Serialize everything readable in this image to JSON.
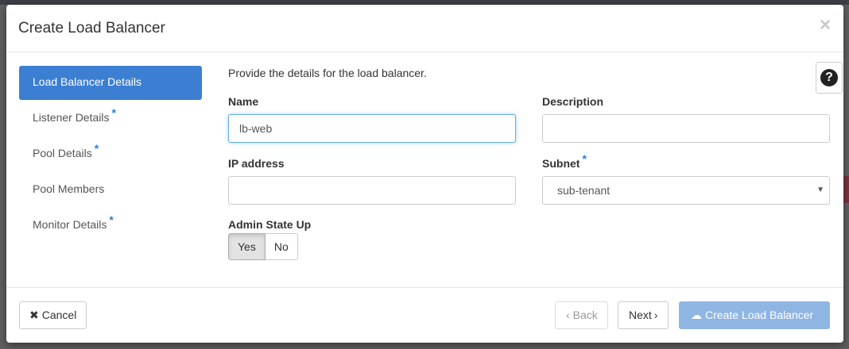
{
  "modal": {
    "title": "Create Load Balancer",
    "close_glyph": "×"
  },
  "wizard": {
    "steps": [
      {
        "label": "Load Balancer Details",
        "required": false,
        "active": true
      },
      {
        "label": "Listener Details",
        "required": true,
        "active": false
      },
      {
        "label": "Pool Details",
        "required": true,
        "active": false
      },
      {
        "label": "Pool Members",
        "required": false,
        "active": false
      },
      {
        "label": "Monitor Details",
        "required": true,
        "active": false
      }
    ],
    "required_marker": "*"
  },
  "help": {
    "glyph": "?"
  },
  "form": {
    "intro": "Provide the details for the load balancer.",
    "name_label": "Name",
    "name_value": "lb-web",
    "description_label": "Description",
    "description_value": "",
    "ip_label": "IP address",
    "ip_value": "",
    "subnet_label": "Subnet",
    "subnet_required_marker": "*",
    "subnet_selected": "sub-tenant",
    "admin_state_label": "Admin State Up",
    "admin_yes": "Yes",
    "admin_no": "No",
    "admin_selected": "Yes"
  },
  "footer": {
    "cancel_label": "Cancel",
    "back_label": "Back",
    "next_label": "Next",
    "create_label": "Create Load Balancer"
  },
  "colors": {
    "accent": "#3c7fd2",
    "primary_disabled": "#8fb5e3",
    "required_star": "#2a7dd4"
  }
}
